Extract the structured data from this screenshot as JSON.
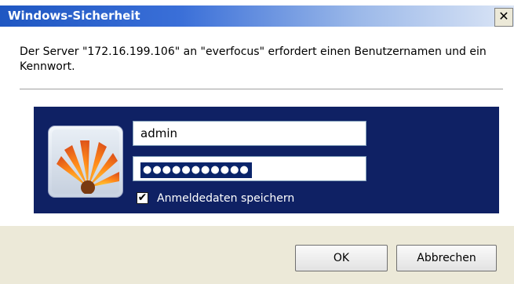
{
  "dialog": {
    "title": "Windows-Sicherheit",
    "close_glyph": "✕",
    "message": "Der Server \"172.16.199.106\" an \"everfocus\" erfordert einen Benutzernamen und ein Kennwort."
  },
  "credentials": {
    "user_tile_icon": "user-tile-flower-icon",
    "username_value": "admin",
    "password_mask": "●●●●●●●●●●●",
    "remember_checked": true,
    "check_glyph": "✔",
    "remember_label": "Anmeldedaten speichern"
  },
  "buttons": {
    "ok_label": "OK",
    "cancel_label": "Abbrechen"
  },
  "colors": {
    "title_bar": "#1f57c2",
    "credential_panel": "#0f2164",
    "footer": "#ece9d8"
  }
}
